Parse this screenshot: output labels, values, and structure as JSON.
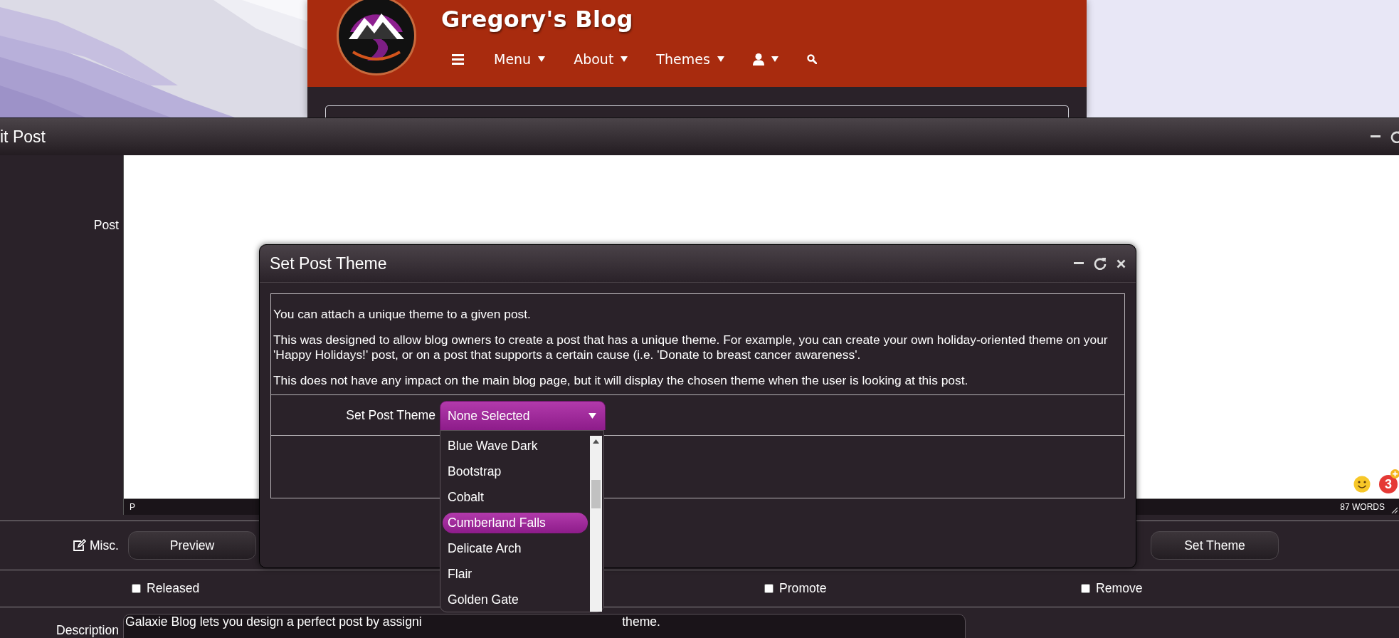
{
  "blog": {
    "title": "Gregory's Blog",
    "nav": [
      {
        "kind": "menu"
      },
      {
        "kind": "link",
        "label": "Menu"
      },
      {
        "kind": "link",
        "label": "About"
      },
      {
        "kind": "link",
        "label": "Themes"
      },
      {
        "kind": "user"
      },
      {
        "kind": "search"
      }
    ]
  },
  "edit_window": {
    "title": "it Post",
    "post_label": "Post",
    "editor": {
      "element_path": "P",
      "word_count": "87 WORDS",
      "notification_count": "3"
    },
    "misc_label": "Misc.",
    "buttons": [
      "Preview",
      "Set Theme"
    ],
    "checkboxes": [
      {
        "label": "Released",
        "checked": false
      },
      {
        "label": "Promote",
        "checked": false
      },
      {
        "label": "Remove",
        "checked": false
      }
    ],
    "description": {
      "label": "Description",
      "value_start": "Galaxie Blog lets you design a perfect post by assigni",
      "value_end": "theme."
    }
  },
  "dialog": {
    "title": "Set Post Theme",
    "paragraphs": [
      "You can attach a unique theme to a given post.",
      "This was designed to allow blog owners to create a post that has a unique theme. For example, you can create your own holiday-oriented theme on your 'Happy Holidays!' post, or on a post that supports a certain cause (i.e. 'Donate to breast cancer awareness'.",
      "This does not have any impact on the main blog page, but it will display the chosen theme when the user is looking at this post."
    ],
    "select": {
      "label": "Set Post Theme",
      "value": "None Selected",
      "options": [
        {
          "label": "Blue Wave Dark",
          "selected": false
        },
        {
          "label": "Bootstrap",
          "selected": false
        },
        {
          "label": "Cobalt",
          "selected": false
        },
        {
          "label": "Cumberland Falls",
          "selected": true
        },
        {
          "label": "Delicate Arch",
          "selected": false
        },
        {
          "label": "Flair",
          "selected": false
        },
        {
          "label": "Golden Gate",
          "selected": false
        }
      ]
    }
  }
}
